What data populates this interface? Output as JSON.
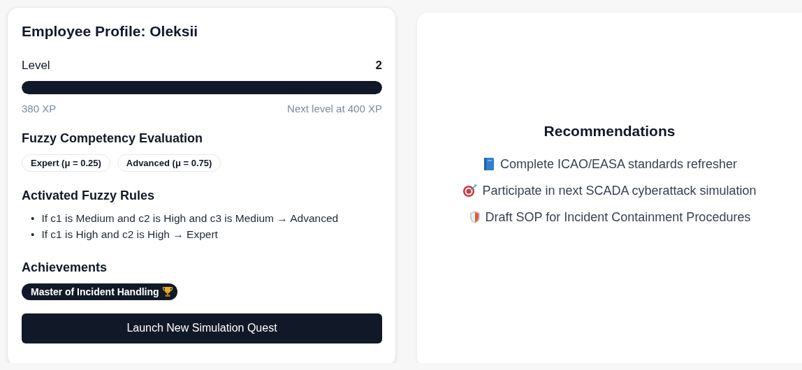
{
  "profile": {
    "title": "Employee Profile: Oleksii",
    "level_label": "Level",
    "level_value": "2",
    "progress": {
      "level": 1
    },
    "xp": "380 XP",
    "next_level": "Next level at 400 XP",
    "competency": {
      "title": "Fuzzy Competency Evaluation",
      "tags": [
        "Expert (μ = 0.25)",
        "Advanced (μ = 0.75)"
      ]
    },
    "rules": {
      "title": "Activated Fuzzy Rules",
      "items": [
        {
          "bullet": "•",
          "text": "If c1 is Medium and c2 is High and c3 is Medium → Advanced"
        },
        {
          "bullet": "•",
          "text": "If c1 is High and c2 is High → Expert"
        }
      ]
    },
    "achievements": {
      "title": "Achievements",
      "items": [
        {
          "label": "Master of Incident Handling",
          "kind": "trophy"
        }
      ]
    },
    "button": "Launch New Simulation Quest"
  },
  "recommendations": {
    "title": "Recommendations",
    "items": [
      {
        "kind": "book",
        "text": "Complete ICAO/EASA standards refresher"
      },
      {
        "kind": "target",
        "text": "Participate in next SCADA cyberattack simulation"
      },
      {
        "kind": "shield",
        "text": "Draft SOP for Incident Containment Procedures"
      }
    ]
  }
}
